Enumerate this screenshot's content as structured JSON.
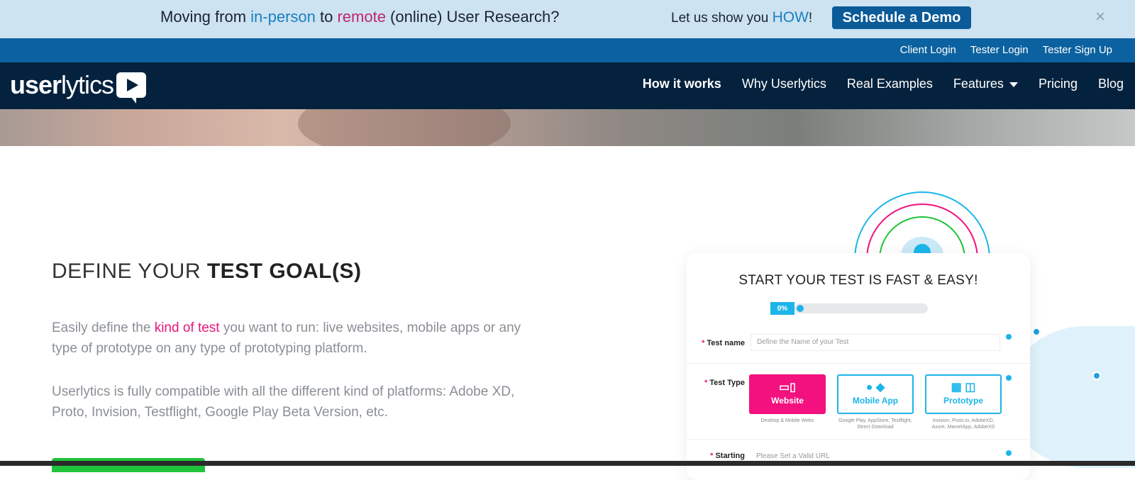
{
  "promo": {
    "text_part1": "Moving from ",
    "text_part2": "in-person",
    "text_part3": " to ",
    "text_part4": "remote",
    "text_part5": " (online) User Research?",
    "sub_part1": "Let us show you ",
    "sub_how": "HOW",
    "sub_part2": "!",
    "demo_button": "Schedule a Demo",
    "close": "×"
  },
  "loginbar": {
    "links": [
      "Client Login",
      "Tester Login",
      "Tester Sign Up"
    ]
  },
  "nav": {
    "logo_bold": "user",
    "logo_light": "lytics",
    "items": [
      "How it works",
      "Why Userlytics",
      "Real Examples",
      "Features",
      "Pricing",
      "Blog"
    ]
  },
  "content": {
    "heading_light": "DEFINE YOUR ",
    "heading_bold": "TEST GOAL(S)",
    "para1_a": "Easily define the ",
    "para1_highlight": "kind of test",
    "para1_b": " you want to run: live websites, mobile apps or any type of prototype on any type of prototyping platform.",
    "para2": "Userlytics is fully compatible with all the different kind of platforms: Adobe XD, Proto, Invision, Testflight, Google Play Beta Version, etc."
  },
  "card": {
    "title": "START YOUR TEST IS FAST & EASY!",
    "progress_label": "0%",
    "progress": 0,
    "test_name_label": "Test name",
    "test_name_placeholder": "Define the Name of your Test",
    "test_type_label": "Test Type",
    "types": [
      {
        "label": "Website",
        "icon": "desktop-mobile-icon",
        "caption": "Desktop & Mobile Webs"
      },
      {
        "label": "Mobile App",
        "icon": "apple-android-icon",
        "caption": "Google Play, AppStore, Testflight, Direct Download"
      },
      {
        "label": "Prototype",
        "icon": "grid-layout-icon",
        "caption": "Invision, Proto.io, AdobeXD, Axure, MarvelApp, AdobeXD"
      }
    ],
    "starting_label": "Starting",
    "url_placeholder": "Please Set a Valid URL"
  },
  "colors": {
    "promo_bg": "#cde3f1",
    "login_bar": "#0c62a0",
    "nav_bg": "#04223d",
    "accent_pink": "#e3177d",
    "accent_cyan": "#1cb5ea",
    "demo_button": "#0b5b98",
    "cta_green": "#1ec43a"
  }
}
